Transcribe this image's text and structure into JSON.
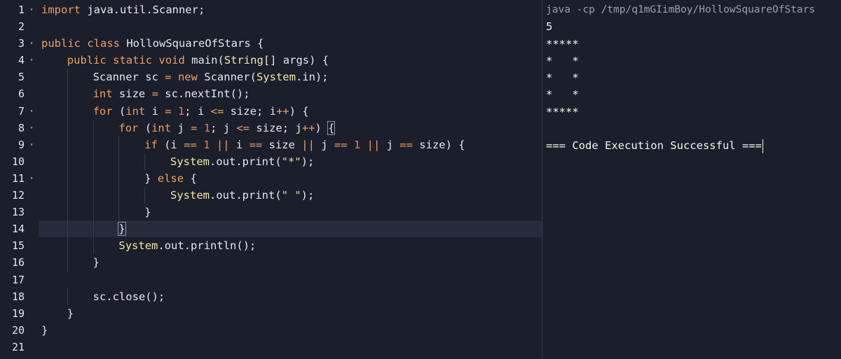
{
  "editor": {
    "lines": [
      {
        "n": "1",
        "fold": true,
        "indent": 0,
        "active": false,
        "tokens": [
          [
            "kw",
            "import"
          ],
          [
            "pl",
            " java.util.Scanner;"
          ]
        ]
      },
      {
        "n": "2",
        "fold": false,
        "indent": 0,
        "active": false,
        "tokens": []
      },
      {
        "n": "3",
        "fold": true,
        "indent": 0,
        "active": false,
        "tokens": [
          [
            "kw",
            "public"
          ],
          [
            "pl",
            " "
          ],
          [
            "kw",
            "class"
          ],
          [
            "pl",
            " HollowSquareOfStars {"
          ]
        ]
      },
      {
        "n": "4",
        "fold": true,
        "indent": 1,
        "active": false,
        "tokens": [
          [
            "kw",
            "public"
          ],
          [
            "pl",
            " "
          ],
          [
            "kw",
            "static"
          ],
          [
            "pl",
            " "
          ],
          [
            "kw",
            "void"
          ],
          [
            "pl",
            " main("
          ],
          [
            "cls",
            "String"
          ],
          [
            "pl",
            "[] args) {"
          ]
        ]
      },
      {
        "n": "5",
        "fold": false,
        "indent": 2,
        "active": false,
        "tokens": [
          [
            "pl",
            "Scanner sc "
          ],
          [
            "op",
            "="
          ],
          [
            "pl",
            " "
          ],
          [
            "kw",
            "new"
          ],
          [
            "pl",
            " Scanner("
          ],
          [
            "cls",
            "System"
          ],
          [
            "pl",
            ".in);"
          ]
        ]
      },
      {
        "n": "6",
        "fold": false,
        "indent": 2,
        "active": false,
        "tokens": [
          [
            "ty",
            "int"
          ],
          [
            "pl",
            " size "
          ],
          [
            "op",
            "="
          ],
          [
            "pl",
            " sc.nextInt();"
          ]
        ]
      },
      {
        "n": "7",
        "fold": true,
        "indent": 2,
        "active": false,
        "tokens": [
          [
            "kw",
            "for"
          ],
          [
            "pl",
            " ("
          ],
          [
            "ty",
            "int"
          ],
          [
            "pl",
            " i "
          ],
          [
            "op",
            "="
          ],
          [
            "pl",
            " "
          ],
          [
            "num",
            "1"
          ],
          [
            "pl",
            "; i "
          ],
          [
            "op",
            "<="
          ],
          [
            "pl",
            " size; i"
          ],
          [
            "op",
            "++"
          ],
          [
            "pl",
            ") {"
          ]
        ]
      },
      {
        "n": "8",
        "fold": true,
        "indent": 3,
        "active": false,
        "tokens": [
          [
            "kw",
            "for"
          ],
          [
            "pl",
            " ("
          ],
          [
            "ty",
            "int"
          ],
          [
            "pl",
            " j "
          ],
          [
            "op",
            "="
          ],
          [
            "pl",
            " "
          ],
          [
            "num",
            "1"
          ],
          [
            "pl",
            "; j "
          ],
          [
            "op",
            "<="
          ],
          [
            "pl",
            " size; j"
          ],
          [
            "op",
            "++"
          ],
          [
            "pl",
            ") "
          ],
          [
            "pl",
            "{"
          ]
        ]
      },
      {
        "n": "9",
        "fold": true,
        "indent": 4,
        "active": false,
        "tokens": [
          [
            "kw",
            "if"
          ],
          [
            "pl",
            " (i "
          ],
          [
            "op",
            "=="
          ],
          [
            "pl",
            " "
          ],
          [
            "num",
            "1"
          ],
          [
            "pl",
            " "
          ],
          [
            "op",
            "||"
          ],
          [
            "pl",
            " i "
          ],
          [
            "op",
            "=="
          ],
          [
            "pl",
            " size "
          ],
          [
            "op",
            "||"
          ],
          [
            "pl",
            " j "
          ],
          [
            "op",
            "=="
          ],
          [
            "pl",
            " "
          ],
          [
            "num",
            "1"
          ],
          [
            "pl",
            " "
          ],
          [
            "op",
            "||"
          ],
          [
            "pl",
            " j "
          ],
          [
            "op",
            "=="
          ],
          [
            "pl",
            " size) {"
          ]
        ]
      },
      {
        "n": "10",
        "fold": false,
        "indent": 5,
        "active": false,
        "tokens": [
          [
            "cls",
            "System"
          ],
          [
            "pl",
            ".out.print("
          ],
          [
            "str",
            "\"*\""
          ],
          [
            "pl",
            ");"
          ]
        ]
      },
      {
        "n": "11",
        "fold": true,
        "indent": 4,
        "active": false,
        "tokens": [
          [
            "pl",
            "} "
          ],
          [
            "kw",
            "else"
          ],
          [
            "pl",
            " {"
          ]
        ]
      },
      {
        "n": "12",
        "fold": false,
        "indent": 5,
        "active": false,
        "tokens": [
          [
            "cls",
            "System"
          ],
          [
            "pl",
            ".out.print("
          ],
          [
            "str",
            "\" \""
          ],
          [
            "pl",
            ");"
          ]
        ]
      },
      {
        "n": "13",
        "fold": false,
        "indent": 4,
        "active": false,
        "tokens": [
          [
            "pl",
            "}"
          ]
        ]
      },
      {
        "n": "14",
        "fold": false,
        "indent": 3,
        "active": true,
        "tokens": [
          [
            "pl",
            "}"
          ]
        ]
      },
      {
        "n": "15",
        "fold": false,
        "indent": 3,
        "active": false,
        "tokens": [
          [
            "cls",
            "System"
          ],
          [
            "pl",
            ".out.println();"
          ]
        ]
      },
      {
        "n": "16",
        "fold": false,
        "indent": 2,
        "active": false,
        "tokens": [
          [
            "pl",
            "}"
          ]
        ]
      },
      {
        "n": "17",
        "fold": false,
        "indent": 0,
        "active": false,
        "tokens": []
      },
      {
        "n": "18",
        "fold": false,
        "indent": 2,
        "active": false,
        "tokens": [
          [
            "pl",
            "sc.close();"
          ]
        ]
      },
      {
        "n": "19",
        "fold": false,
        "indent": 1,
        "active": false,
        "tokens": [
          [
            "pl",
            "}"
          ]
        ]
      },
      {
        "n": "20",
        "fold": false,
        "indent": 0,
        "active": false,
        "tokens": [
          [
            "pl",
            "}"
          ]
        ]
      },
      {
        "n": "21",
        "fold": false,
        "indent": 0,
        "active": false,
        "tokens": []
      }
    ]
  },
  "output": {
    "command": "java -cp /tmp/q1mGIimBoy/HollowSquareOfStars",
    "lines": [
      "5",
      "*****",
      "*   *",
      "*   *",
      "*   *",
      "*****",
      "",
      "=== Code Execution Successful ==="
    ]
  }
}
